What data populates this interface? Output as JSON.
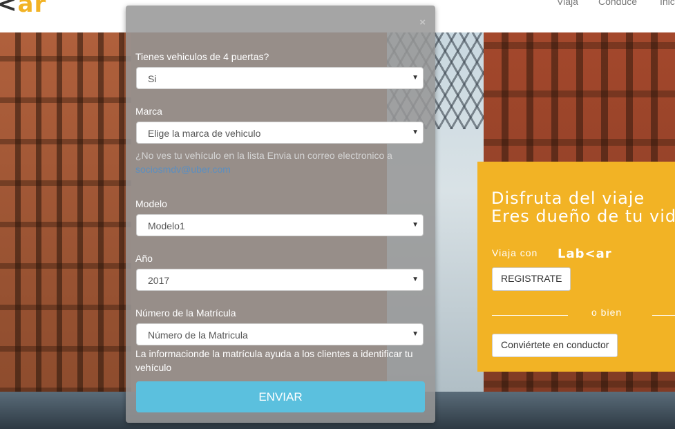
{
  "header": {
    "logo": {
      "pre": "<",
      "post": "ar"
    },
    "nav": [
      "Viaja",
      "Conduce",
      "Inic"
    ]
  },
  "modal": {
    "close": "×",
    "doors": {
      "label": "Tienes vehiculos de 4 puertas?",
      "value": "Si"
    },
    "brand": {
      "label": "Marca",
      "value": "Elige la marca de vehiculo"
    },
    "help": {
      "text": "¿No ves tu vehículo en la lista Envia un correo electronico a",
      "email": "sociosmdv@uber.com"
    },
    "model": {
      "label": "Modelo",
      "value": "Modelo1"
    },
    "year": {
      "label": "Año",
      "value": "2017"
    },
    "plate": {
      "label": "Número de la Matrícula",
      "value": "Número de la Matricula"
    },
    "note": "La informacionde la matrícula ayuda a los clientes a identificar tu vehículo",
    "submit": "ENVIAR"
  },
  "promo": {
    "line1": "Disfruta del viaje",
    "line2": "Eres dueño de tu vida",
    "viaja": "Viaja con",
    "brand": "Lab<ar",
    "register": "REGISTRATE",
    "or": "o bien",
    "driver": "Conviértete en conductor"
  }
}
